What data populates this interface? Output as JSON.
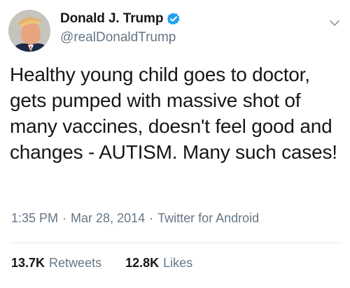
{
  "author": {
    "display_name": "Donald J. Trump",
    "handle": "@realDonaldTrump",
    "verified": true,
    "avatar_icon": "profile-photo"
  },
  "tweet": {
    "text": "Healthy young child goes to doctor, gets pumped with massive shot of many vaccines, doesn't feel good and changes - AUTISM. Many such cases!",
    "time": "1:35 PM",
    "separator": "·",
    "date": "Mar 28, 2014",
    "source": "Twitter for Android"
  },
  "stats": {
    "retweets_count": "13.7K",
    "retweets_label": "Retweets",
    "likes_count": "12.8K",
    "likes_label": "Likes"
  },
  "colors": {
    "text": "#14171a",
    "secondary": "#657786",
    "verified_badge": "#1da1f2",
    "divider": "#e1e8ed"
  },
  "icons": {
    "verified": "verified-badge-icon",
    "menu": "chevron-down-icon"
  }
}
